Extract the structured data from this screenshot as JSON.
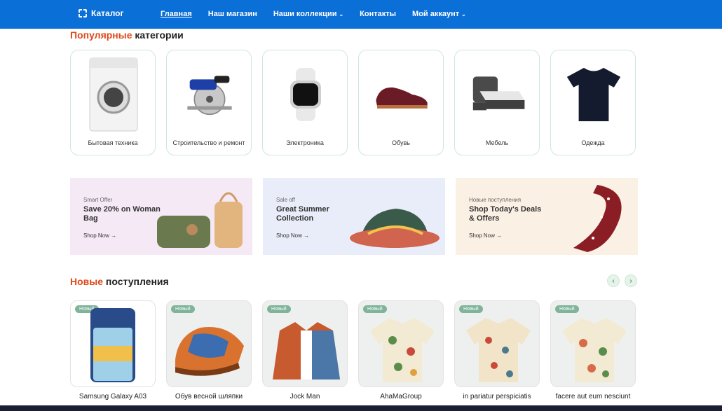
{
  "header": {
    "brand": "Каталог",
    "nav": [
      {
        "label": "Главная",
        "active": true
      },
      {
        "label": "Наш магазин"
      },
      {
        "label": "Наши коллекции",
        "caret": "⌄"
      },
      {
        "label": "Контакты"
      },
      {
        "label": "Мой аккаунт",
        "caret": "⌄"
      }
    ]
  },
  "popular": {
    "title_accent": "Популярные",
    "title_rest": "категории",
    "items": [
      {
        "label": "Бытовая техника",
        "icon": "washing-machine-icon"
      },
      {
        "label": "Строительство и ремонт",
        "icon": "circular-saw-icon"
      },
      {
        "label": "Электроника",
        "icon": "smartwatch-icon"
      },
      {
        "label": "Обувь",
        "icon": "shoe-icon"
      },
      {
        "label": "Мебель",
        "icon": "bed-icon"
      },
      {
        "label": "Одежда",
        "icon": "tshirt-icon"
      }
    ]
  },
  "banners": [
    {
      "kicker": "Smart Offer",
      "title": "Save 20% on Woman Bag",
      "cta": "Shop Now →",
      "bg": "#f6e9f6"
    },
    {
      "kicker": "Sale off",
      "title": "Great Summer Collection",
      "cta": "Shop Now →",
      "bg": "#e9edf9"
    },
    {
      "kicker": "Новые поступления",
      "title": "Shop Today's Deals & Offers",
      "cta": "Shop Now →",
      "bg": "#fbf0e4"
    }
  ],
  "arrivals": {
    "title_accent": "Новые",
    "title_rest": "поступления",
    "prev": "‹",
    "next": "›",
    "badge": "Новый",
    "items": [
      {
        "name": "Samsung Galaxy A03"
      },
      {
        "name": "Обув весной шляпки"
      },
      {
        "name": "Jock Man"
      },
      {
        "name": "AhaMaGroup"
      },
      {
        "name": "in pariatur perspiciatis"
      },
      {
        "name": "facere aut eum nesciunt"
      }
    ]
  },
  "colors": {
    "accent": "#e0491b",
    "primary": "#0a6fd6",
    "green": "#7fb39a"
  }
}
